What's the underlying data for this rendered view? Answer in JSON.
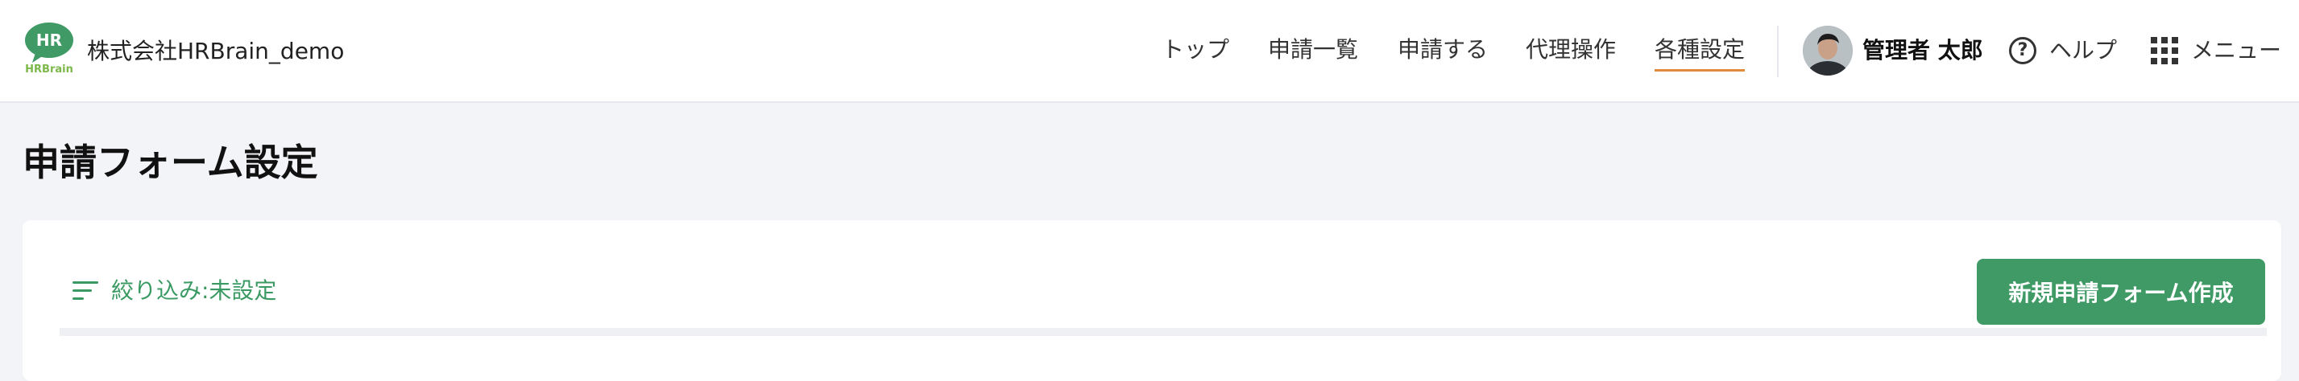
{
  "header": {
    "logo_text": "HR",
    "logo_brand": "HRBrain",
    "company_name": "株式会社HRBrain_demo",
    "nav": [
      {
        "label": "トップ"
      },
      {
        "label": "申請一覧"
      },
      {
        "label": "申請する"
      },
      {
        "label": "代理操作"
      },
      {
        "label": "各種設定",
        "active": true
      }
    ],
    "user_name": "管理者 太郎",
    "help_label": "ヘルプ",
    "menu_label": "メニュー"
  },
  "page": {
    "title": "申請フォーム設定"
  },
  "toolbar": {
    "filter_label": "絞り込み:未設定",
    "create_button_label": "新規申請フォーム作成"
  },
  "colors": {
    "brand_green": "#3f9a66",
    "active_underline": "#e08a3c",
    "page_background": "#f3f4f8"
  },
  "icons": {
    "help": "question-circle-icon",
    "menu": "grid-icon",
    "filter": "filter-lines-icon"
  }
}
